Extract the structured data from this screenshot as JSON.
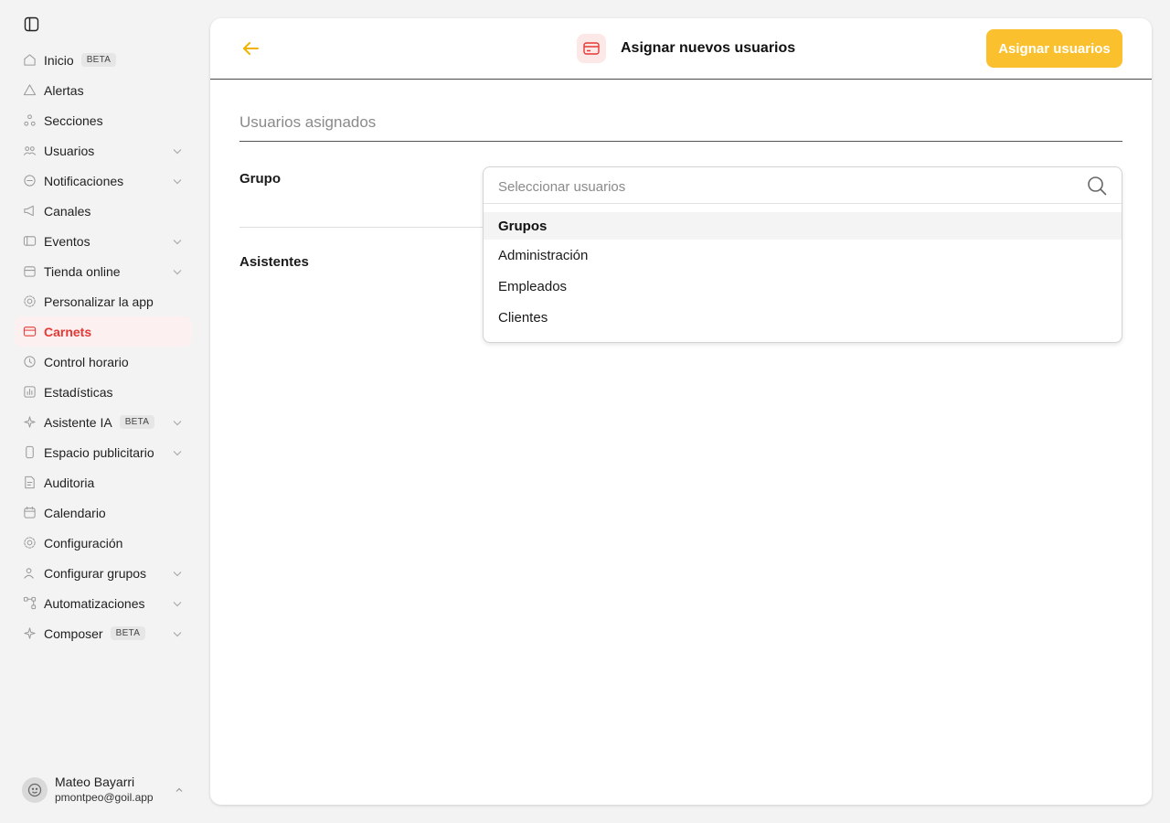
{
  "sidebar": {
    "items": [
      {
        "label": "Inicio",
        "icon": "home-icon",
        "badge": "BETA",
        "chevron": false,
        "active": false
      },
      {
        "label": "Alertas",
        "icon": "alert-icon",
        "badge": "",
        "chevron": false,
        "active": false
      },
      {
        "label": "Secciones",
        "icon": "sections-icon",
        "badge": "",
        "chevron": false,
        "active": false
      },
      {
        "label": "Usuarios",
        "icon": "users-icon",
        "badge": "",
        "chevron": true,
        "active": false
      },
      {
        "label": "Notificaciones",
        "icon": "chat-icon",
        "badge": "",
        "chevron": true,
        "active": false
      },
      {
        "label": "Canales",
        "icon": "megaphone-icon",
        "badge": "",
        "chevron": false,
        "active": false
      },
      {
        "label": "Eventos",
        "icon": "ticket-icon",
        "badge": "",
        "chevron": true,
        "active": false
      },
      {
        "label": "Tienda online",
        "icon": "store-icon",
        "badge": "",
        "chevron": true,
        "active": false
      },
      {
        "label": "Personalizar la app",
        "icon": "gear-icon",
        "badge": "",
        "chevron": false,
        "active": false
      },
      {
        "label": "Carnets",
        "icon": "card-icon",
        "badge": "",
        "chevron": false,
        "active": true
      },
      {
        "label": "Control horario",
        "icon": "clock-icon",
        "badge": "",
        "chevron": false,
        "active": false
      },
      {
        "label": "Estadísticas",
        "icon": "chart-icon",
        "badge": "",
        "chevron": false,
        "active": false
      },
      {
        "label": "Asistente IA",
        "icon": "sparkle-icon",
        "badge": "BETA",
        "chevron": true,
        "active": false
      },
      {
        "label": "Espacio publicitario",
        "icon": "phone-icon",
        "badge": "",
        "chevron": true,
        "active": false
      },
      {
        "label": "Auditoria",
        "icon": "document-icon",
        "badge": "",
        "chevron": false,
        "active": false
      },
      {
        "label": "Calendario",
        "icon": "calendar-icon",
        "badge": "",
        "chevron": false,
        "active": false
      },
      {
        "label": "Configuración",
        "icon": "settings-icon",
        "badge": "",
        "chevron": false,
        "active": false
      },
      {
        "label": "Configurar grupos",
        "icon": "group-icon",
        "badge": "",
        "chevron": true,
        "active": false
      },
      {
        "label": "Automatizaciones",
        "icon": "flow-icon",
        "badge": "",
        "chevron": true,
        "active": false
      },
      {
        "label": "Composer",
        "icon": "sparkle-icon",
        "badge": "BETA",
        "chevron": true,
        "active": false
      }
    ]
  },
  "user": {
    "name": "Mateo Bayarri",
    "email": "pmontpeo@goil.app"
  },
  "header": {
    "title": "Asignar nuevos usuarios",
    "assign_button": "Asignar usuarios"
  },
  "main": {
    "section_title": "Usuarios asignados",
    "grupo_label": "Grupo",
    "asistentes_label": "Asistentes"
  },
  "dropdown": {
    "placeholder": "Seleccionar usuarios",
    "group_header": "Grupos",
    "options": [
      "Administración",
      "Empleados",
      "Clientes"
    ]
  },
  "colors": {
    "accent": "#fbc02d",
    "active": "#e53935",
    "active_bg": "#fdf0f0"
  }
}
